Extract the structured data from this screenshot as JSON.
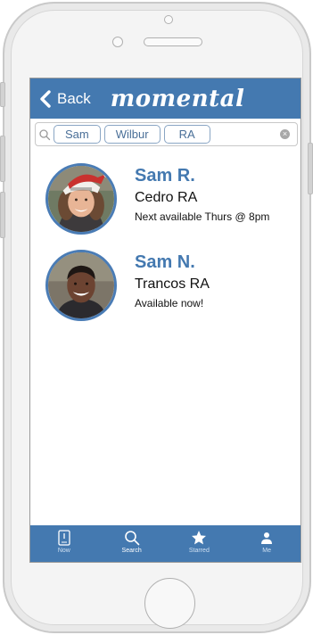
{
  "header": {
    "back_label": "Back",
    "brand": "momental"
  },
  "search": {
    "tokens": [
      "Sam",
      "Wilbur",
      "RA"
    ],
    "clear_glyph": "×"
  },
  "results": [
    {
      "name": "Sam R.",
      "dorm": "Cedro RA",
      "status": "Next available Thurs @ 8pm",
      "avatar": "photo-woman-santa-hat"
    },
    {
      "name": "Sam N.",
      "dorm": "Trancos RA",
      "status": "Available now!",
      "avatar": "photo-man-smiling"
    }
  ],
  "tabbar": {
    "items": [
      {
        "label": "Now",
        "icon": "phone-icon",
        "active": false
      },
      {
        "label": "Search",
        "icon": "search-icon",
        "active": true
      },
      {
        "label": "Starred",
        "icon": "star-icon",
        "active": false
      },
      {
        "label": "Me",
        "icon": "person-icon",
        "active": false
      }
    ]
  },
  "colors": {
    "brand_blue": "#4479b0",
    "name_blue": "#4479b0",
    "token_border": "#8aa6c4"
  }
}
